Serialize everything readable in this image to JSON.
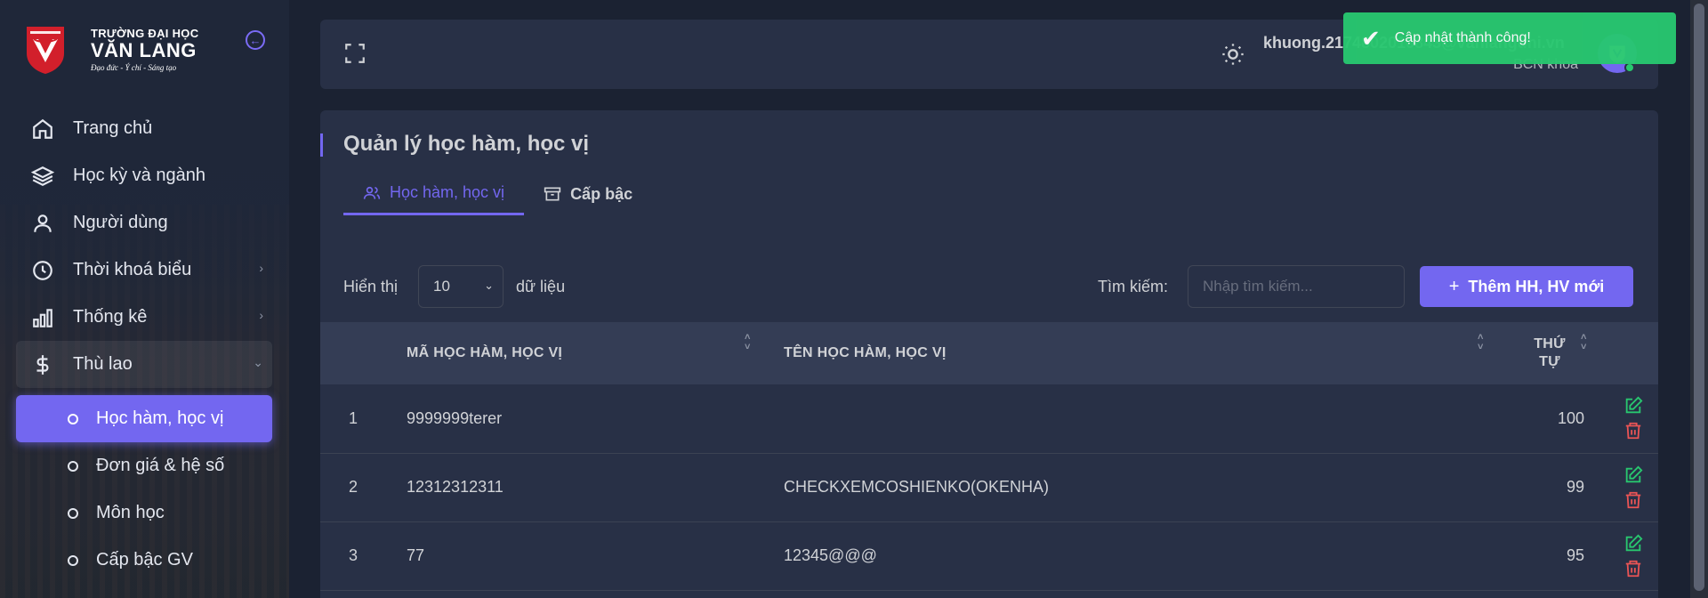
{
  "brand": {
    "line1": "TRƯỜNG ĐẠI HỌC",
    "line2": "VĂN LANG",
    "line3": "Đạo đức - Ý chí - Sáng tạo",
    "logo_color": "#d21f2b"
  },
  "sidebar": {
    "items": [
      {
        "label": "Trang chủ",
        "icon": "home-icon"
      },
      {
        "label": "Học kỳ và ngành",
        "icon": "layers-icon"
      },
      {
        "label": "Người dùng",
        "icon": "user-icon"
      },
      {
        "label": "Thời khoá biểu",
        "icon": "clock-icon",
        "has_children": true
      },
      {
        "label": "Thống kê",
        "icon": "bar-chart-icon",
        "has_children": true
      },
      {
        "label": "Thù lao",
        "icon": "dollar-icon",
        "has_children": true,
        "open": true
      }
    ],
    "sub_items": [
      {
        "label": "Học hàm, học vị",
        "active": true
      },
      {
        "label": "Đơn giá & hệ số"
      },
      {
        "label": "Môn học"
      },
      {
        "label": "Cấp bậc GV"
      }
    ]
  },
  "header": {
    "user_name": "khuong.2174802010843@vanlanguni.vn",
    "user_role": "BCN khoa",
    "status_color": "#28c76f"
  },
  "toast": {
    "message": "Cập nhật thành công!",
    "color": "#28c76f"
  },
  "page": {
    "title": "Quản lý học hàm, học vị",
    "tabs": [
      {
        "label": "Học hàm, học vị",
        "active": true,
        "icon": "users-icon"
      },
      {
        "label": "Cấp bậc",
        "icon": "archive-icon"
      }
    ],
    "show_label": "Hiển thị",
    "page_size": "10",
    "entries_label": "dữ liệu",
    "search_label": "Tìm kiếm:",
    "search_placeholder": "Nhập tìm kiếm...",
    "search_value": "",
    "add_button": "Thêm HH, HV mới",
    "accent_color": "#7367f0"
  },
  "table": {
    "columns": [
      "",
      "MÃ HỌC HÀM, HỌC VỊ",
      "TÊN HỌC HÀM, HỌC VỊ",
      "THỨ TỰ"
    ],
    "rows": [
      {
        "index": "1",
        "code": "9999999terer",
        "name": "",
        "order": "100"
      },
      {
        "index": "2",
        "code": "12312312311",
        "name": "CHECKXEMCOSHIENKO(OKENHA)",
        "order": "99"
      },
      {
        "index": "3",
        "code": "77",
        "name": "12345@@@",
        "order": "95"
      }
    ]
  }
}
